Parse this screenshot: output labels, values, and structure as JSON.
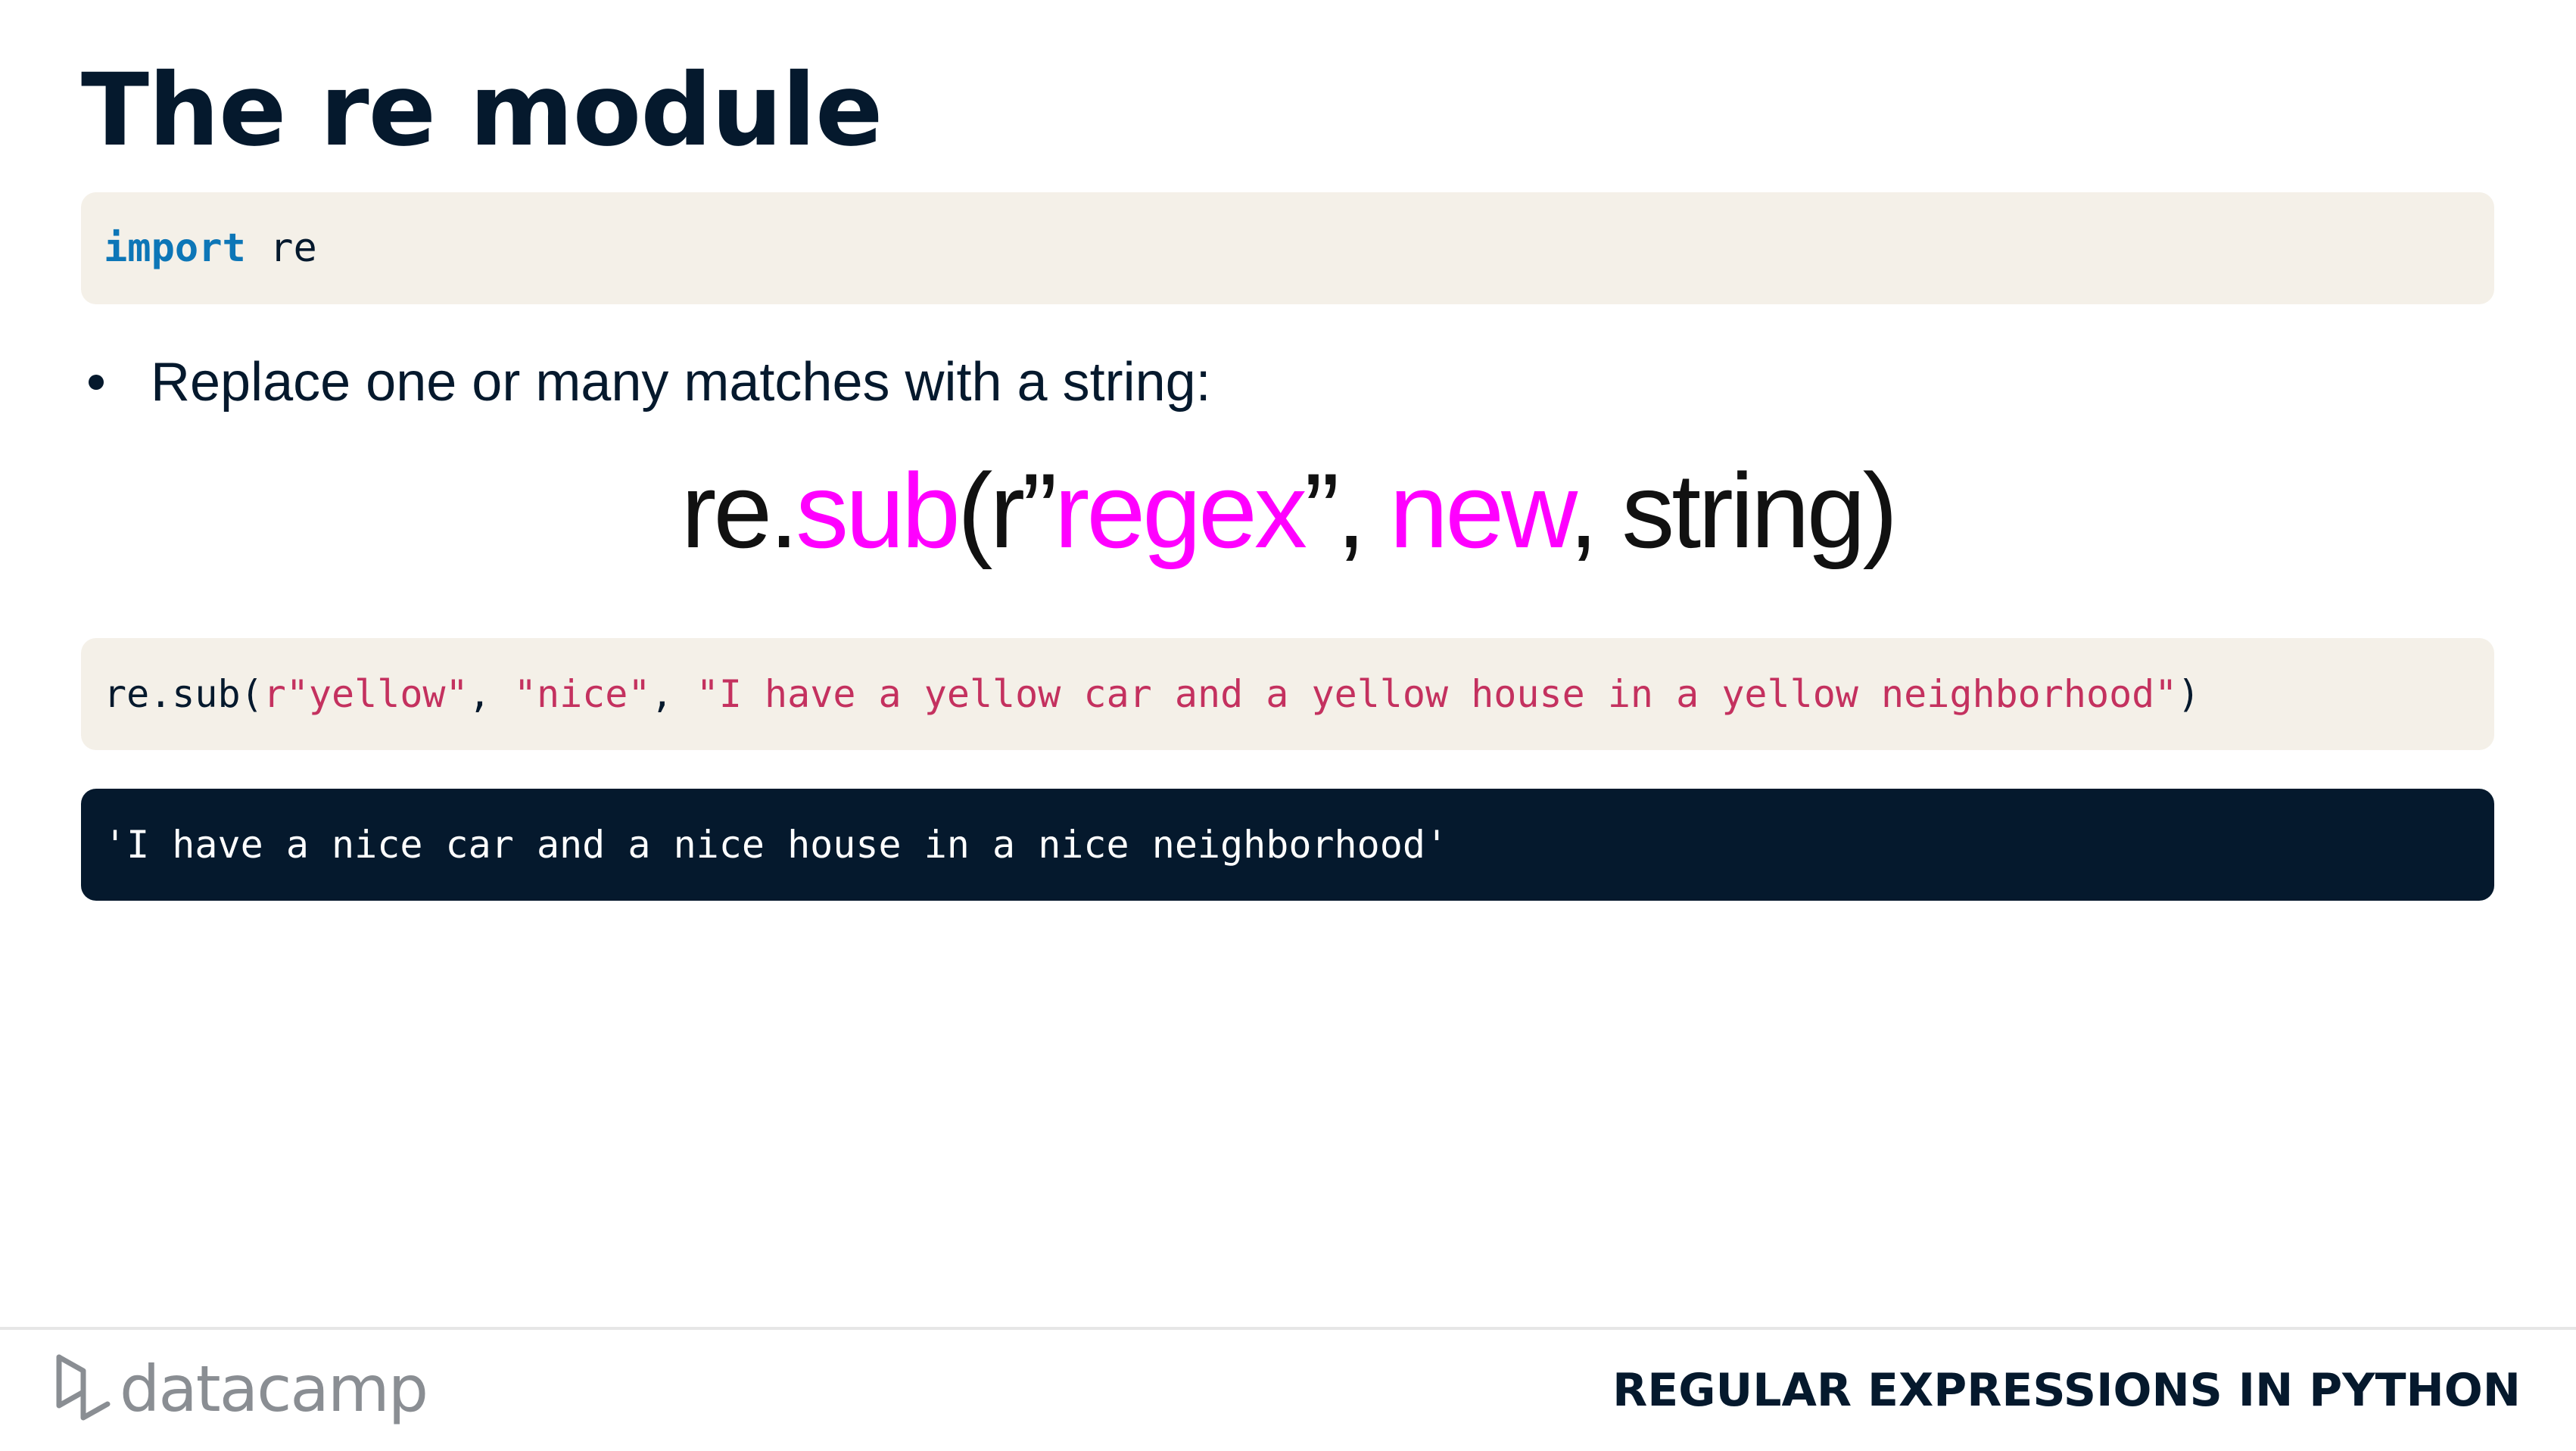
{
  "slide": {
    "title": "The re module",
    "import_code": {
      "keyword": "import",
      "rest": " re"
    },
    "bullet": "Replace one or many matches with a string:",
    "syntax": {
      "prefix": "re.",
      "func": "sub",
      "open": "(r”",
      "regex": "regex",
      "sep": "”, ",
      "new": "new",
      "tail": ", string)"
    },
    "sub_code": {
      "call": "re.sub(",
      "arg1": "r\"yellow\"",
      "comma1": ", ",
      "arg2": "\"nice\"",
      "comma2": ", ",
      "arg3": "\"I have a yellow car and a yellow house in a yellow neighborhood\"",
      "close": ")"
    },
    "output": "'I have a nice car and a nice house in a nice neighborhood'"
  },
  "footer": {
    "brand": "datacamp",
    "logo_icon": "datacamp-logo-icon",
    "course_title": "REGULAR EXPRESSIONS IN PYTHON"
  },
  "colors": {
    "navy": "#05192d",
    "code_bg": "#f4f0e8",
    "keyword": "#0d76b7",
    "string": "#c4315f",
    "magenta": "#ff00ff"
  }
}
